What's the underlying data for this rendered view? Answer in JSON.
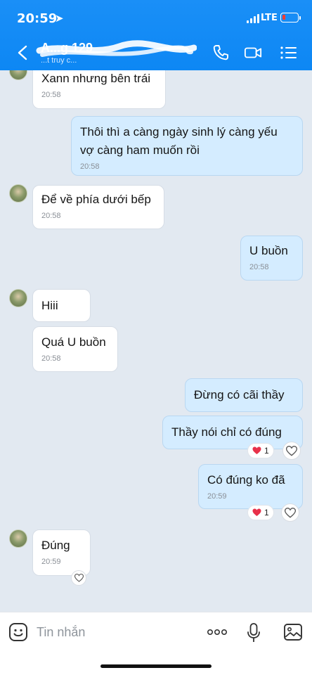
{
  "status_bar": {
    "time": "20:59",
    "network": "LTE",
    "battery_color": "#ff3b30"
  },
  "header": {
    "contact_name": "A...g 129",
    "contact_sub": "...t truy c...",
    "icons": [
      "back-icon",
      "call-icon",
      "video-icon",
      "menu-icon"
    ],
    "color": "#0d87f4"
  },
  "messages": [
    {
      "side": "in",
      "text": "Xann nhưng bên trái",
      "time": "20:58"
    },
    {
      "side": "out",
      "text": "Thôi thì a càng ngày sinh lý càng yếu vợ càng ham muốn rồi",
      "time": "20:58"
    },
    {
      "side": "in",
      "text": "Để về phía dưới bếp",
      "time": "20:58"
    },
    {
      "side": "out",
      "text": "U buồn",
      "time": "20:58"
    },
    {
      "side": "in",
      "text": "Hiii",
      "time": ""
    },
    {
      "side": "in",
      "text": "Quá U buồn",
      "time": "20:58"
    },
    {
      "side": "out",
      "text": "Đừng có cãi thầy",
      "time": ""
    },
    {
      "side": "out",
      "text": "Thầy nói chỉ có đúng",
      "time": "",
      "reaction": {
        "emoji": "heart",
        "count": "1"
      }
    },
    {
      "side": "out",
      "text": "Có đúng ko đã",
      "time": "20:59",
      "reaction": {
        "emoji": "heart",
        "count": "1"
      }
    },
    {
      "side": "in",
      "text": "Đúng",
      "time": "20:59"
    }
  ],
  "input_bar": {
    "placeholder": "Tin nhắn",
    "icons": [
      "emoji-icon",
      "more-icon",
      "mic-icon",
      "image-icon"
    ]
  }
}
